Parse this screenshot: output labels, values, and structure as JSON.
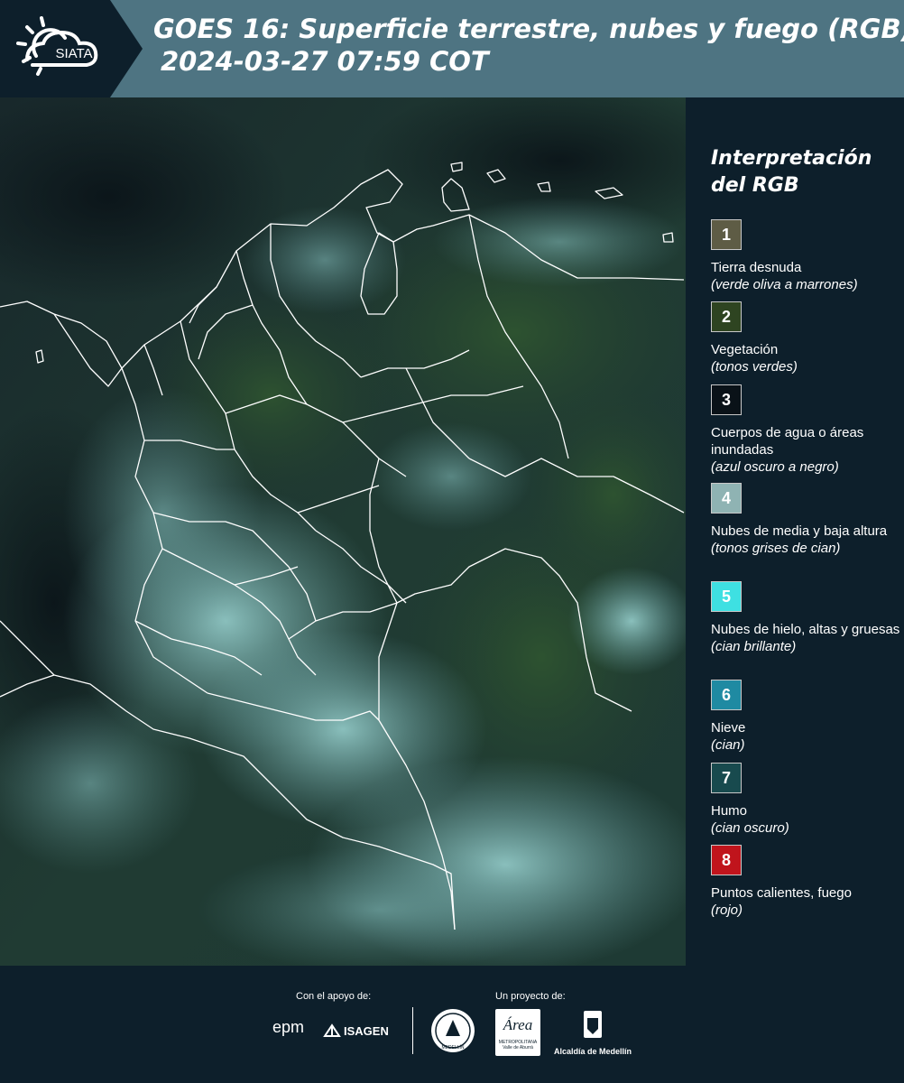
{
  "header": {
    "logo_text": "SIATA",
    "title_line1": "GOES 16: Superficie terrestre, nubes y fuego (RGB)",
    "title_line2": "2024-03-27 07:59 COT"
  },
  "legend": {
    "title": "Interpretación del RGB",
    "items": [
      {
        "number": "1",
        "label": "Tierra desnuda",
        "desc": "(verde oliva a marrones)",
        "color": "#5e5c45",
        "text_color": "#ffffff"
      },
      {
        "number": "2",
        "label": "Vegetación",
        "desc": "(tonos verdes)",
        "color": "#2e4421",
        "text_color": "#ffffff"
      },
      {
        "number": "3",
        "label": "Cuerpos de agua o áreas inundadas",
        "desc": "(azul oscuro a negro)",
        "color": "#0a1218",
        "text_color": "#ffffff"
      },
      {
        "number": "4",
        "label": "Nubes de media y baja altura",
        "desc": "(tonos grises de cian)",
        "color": "#8fb3b3",
        "text_color": "#ffffff"
      },
      {
        "number": "5",
        "label": "Nubes de hielo, altas y gruesas",
        "desc": "(cian brillante)",
        "color": "#3ee0e2",
        "text_color": "#ffffff"
      },
      {
        "number": "6",
        "label": "Nieve",
        "desc": "(cian)",
        "color": "#1f8aa2",
        "text_color": "#ffffff"
      },
      {
        "number": "7",
        "label": "Humo",
        "desc": "(cian oscuro)",
        "color": "#184a4e",
        "text_color": "#ffffff"
      },
      {
        "number": "8",
        "label": "Puntos calientes, fuego",
        "desc": "(rojo)",
        "color": "#c0141c",
        "text_color": "#ffffff"
      }
    ]
  },
  "footer": {
    "support_caption": "Con el apoyo de:",
    "project_caption": "Un proyecto de:",
    "logo_epm": "epm",
    "logo_isagen": "ISAGEN",
    "logo_area_title": "Área",
    "logo_area_sub1": "METROPOLITANA",
    "logo_area_sub2": "Valle de Aburrá",
    "logo_alcaldia": "Alcaldía de Medellín",
    "logo_seal_text": "MEDELLÍN"
  }
}
